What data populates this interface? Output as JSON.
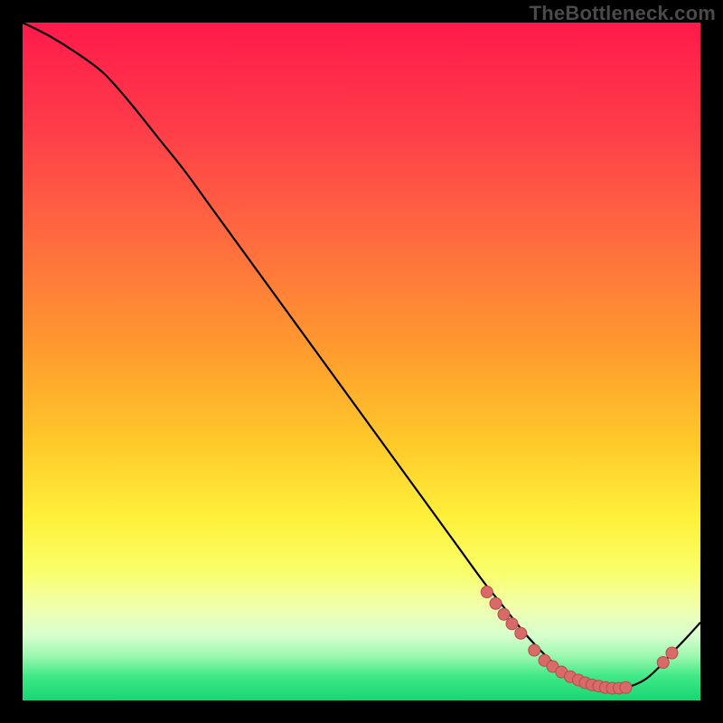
{
  "watermark": "TheBottleneck.com",
  "colors": {
    "bg": "#000000",
    "curve": "#000000",
    "marker_fill": "#d86a6a",
    "marker_stroke": "#b64c4c",
    "gradient_stops": [
      {
        "offset": 0.0,
        "color": "#ff1a4b"
      },
      {
        "offset": 0.15,
        "color": "#ff3b4a"
      },
      {
        "offset": 0.32,
        "color": "#ff6b3f"
      },
      {
        "offset": 0.48,
        "color": "#ff9a2e"
      },
      {
        "offset": 0.62,
        "color": "#ffc92a"
      },
      {
        "offset": 0.73,
        "color": "#fff03a"
      },
      {
        "offset": 0.81,
        "color": "#f9ff6a"
      },
      {
        "offset": 0.865,
        "color": "#f0ffb0"
      },
      {
        "offset": 0.905,
        "color": "#d6ffce"
      },
      {
        "offset": 0.935,
        "color": "#9af7ad"
      },
      {
        "offset": 0.965,
        "color": "#3fe885"
      },
      {
        "offset": 1.0,
        "color": "#17d673"
      }
    ]
  },
  "chart_data": {
    "type": "line",
    "title": "",
    "xlabel": "",
    "ylabel": "",
    "xlim": [
      0,
      100
    ],
    "ylim": [
      0,
      100
    ],
    "grid": false,
    "legend": false,
    "series": [
      {
        "name": "curve",
        "x": [
          0,
          4,
          8,
          12,
          16,
          20,
          24,
          28,
          32,
          36,
          40,
          44,
          48,
          52,
          56,
          60,
          64,
          68,
          70,
          72,
          74,
          76,
          78,
          80,
          82,
          84,
          86,
          88,
          90,
          92,
          94,
          96,
          98,
          100
        ],
        "y": [
          100,
          98,
          95.5,
          92.5,
          88,
          83,
          78,
          72.5,
          67,
          61.5,
          56,
          50.5,
          45,
          39.5,
          34,
          28.5,
          23,
          17.5,
          15,
          12.5,
          10,
          7.8,
          5.8,
          4.2,
          3.0,
          2.2,
          1.8,
          1.8,
          2.2,
          3.2,
          5.0,
          7.2,
          9.3,
          11.5
        ]
      }
    ],
    "markers": {
      "name": "highlight-points",
      "x": [
        68.5,
        69.8,
        71.0,
        72.2,
        73.5,
        75.5,
        77.0,
        78.2,
        79.5,
        80.8,
        82.0,
        83.0,
        84.0,
        85.0,
        86.0,
        87.0,
        88.0,
        89.0,
        94.5,
        95.8
      ],
      "y": [
        16.0,
        14.3,
        12.7,
        11.3,
        9.9,
        7.4,
        5.9,
        5.0,
        4.2,
        3.5,
        3.0,
        2.6,
        2.3,
        2.1,
        1.9,
        1.8,
        1.8,
        1.9,
        5.6,
        7.0
      ]
    }
  }
}
